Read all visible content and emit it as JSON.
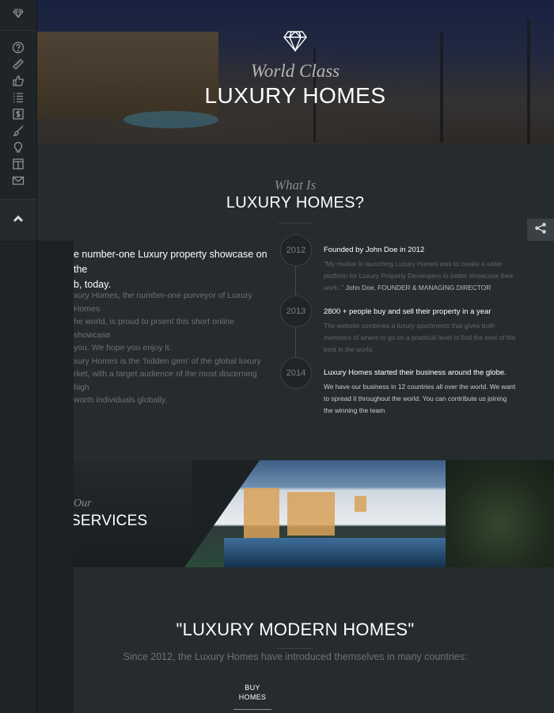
{
  "sidebar": {
    "logo_icon": "diamond-icon",
    "icons": [
      "help-icon",
      "ruler-icon",
      "thumbs-up-icon",
      "list-icon",
      "dollar-icon",
      "brush-icon",
      "lightbulb-icon",
      "layout-icon",
      "mail-icon"
    ],
    "scroll_up_icon": "chevron-up-icon"
  },
  "hero": {
    "subtitle": "World Class",
    "title": "LUXURY HOMES"
  },
  "about": {
    "subtitle": "What Is",
    "title": "LUXURY HOMES?",
    "heading": "e number-one Luxury property showcase on the b, today.",
    "heading_line1": "e number-one Luxury property showcase on the",
    "heading_line2": "b, today.",
    "paragraph_lines": [
      "xury Homes, the number-one purveyor of Luxury Homes",
      "he world, is proud to prsent this short online showcase",
      "you. We hope you enjoy it.",
      "xury Homes is the 'hidden gem' of the global luxury",
      "rket, with a target audience of the most discerning high",
      "worth individuals globally."
    ]
  },
  "timeline": [
    {
      "year": "2012",
      "title": "Founded by John Doe in 2012",
      "text": "\"My motive in launching Luxury Homes was to create a wider platform for Luxury Property Developers to better showcase their work..\"",
      "author": "John Doe, FOUNDER & MANAGING DIRECTOR"
    },
    {
      "year": "2013",
      "title": "2800 + people buy and sell their property in a year",
      "text": "The website combines a luxury apartments that gives both members of where to go on a practical level to find the best of the best in the world."
    },
    {
      "year": "2014",
      "title": "Luxury Homes started their business around the globe.",
      "text": "We have our business in 12 countries all over the world. We want to spread it throughout the world. You can contribute us joining the winning the team"
    }
  ],
  "share": {
    "icon": "share-icon"
  },
  "services": {
    "subtitle": "Our",
    "title": "SERVICES"
  },
  "modern": {
    "title": "\"LUXURY MODERN HOMES\"",
    "text": "Since 2012, the Luxury Homes have introduced themselves in many countries:",
    "buy_line1": "BUY",
    "buy_line2": "HOMES"
  }
}
